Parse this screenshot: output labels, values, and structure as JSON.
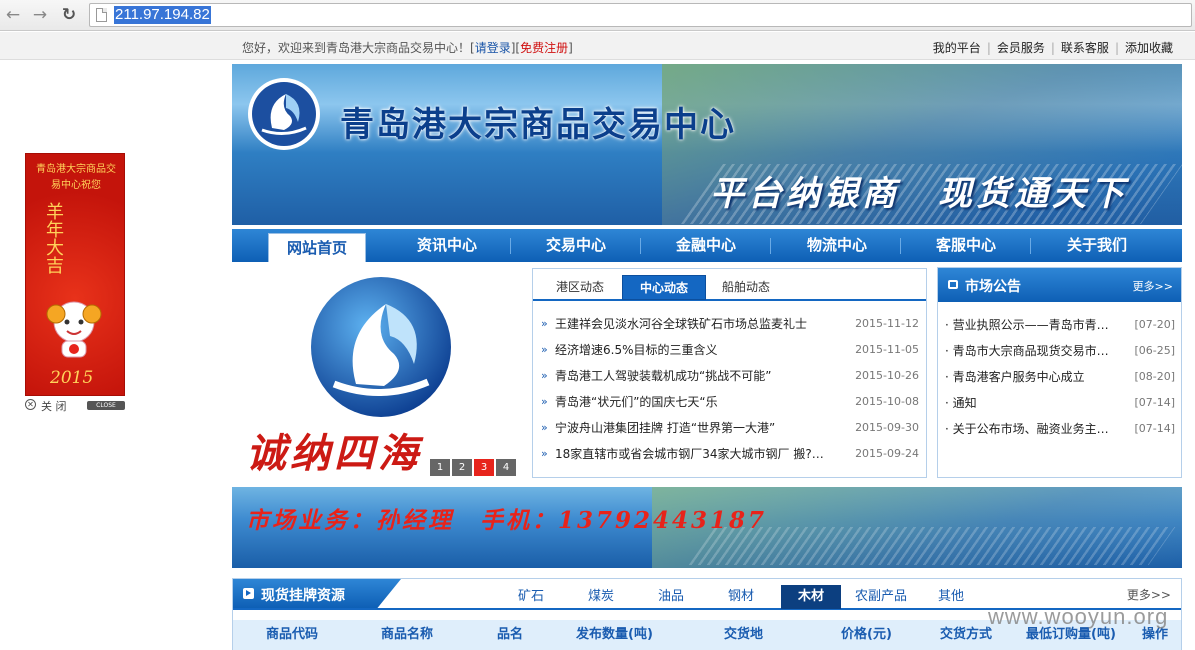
{
  "browser": {
    "url": "211.97.194.82"
  },
  "topbar": {
    "welcome": "您好，欢迎来到青岛港大宗商品交易中心！",
    "login_open": "[",
    "login": "请登录",
    "login_close": "]",
    "register_open": "[",
    "register": "免费注册",
    "register_close": "]",
    "links": [
      "我的平台",
      "会员服务",
      "联系客服",
      "添加收藏"
    ],
    "sep": "|"
  },
  "ad": {
    "top_text": "青岛港大宗商品交易中心祝您",
    "blessing": "羊年大吉",
    "year": "2015",
    "close_label": "关 闭",
    "close_button": "CLOSE"
  },
  "banner": {
    "title": "青岛港大宗商品交易中心",
    "slogan": "平台纳银商　现货通天下"
  },
  "nav": {
    "items": [
      "网站首页",
      "资讯中心",
      "交易中心",
      "金融中心",
      "物流中心",
      "客服中心",
      "关于我们"
    ],
    "active_index": 0
  },
  "slide": {
    "calligraphy": "诚纳四海",
    "dots": [
      "1",
      "2",
      "3",
      "4"
    ],
    "active": 2
  },
  "news": {
    "tabs": [
      "港区动态",
      "中心动态",
      "船舶动态"
    ],
    "active_tab": 1,
    "bullet": "»",
    "items": [
      {
        "title": "王建祥会见淡水河谷全球铁矿石市场总监麦礼士",
        "date": "2015-11-12"
      },
      {
        "title": "经济增速6.5%目标的三重含义",
        "date": "2015-11-05"
      },
      {
        "title": "青岛港工人驾驶装载机成功“挑战不可能”",
        "date": "2015-10-26"
      },
      {
        "title": "青岛港“状元们”的国庆七天“乐",
        "date": "2015-10-08"
      },
      {
        "title": "宁波舟山港集团挂牌 打造“世界第一大港”",
        "date": "2015-09-30"
      },
      {
        "title": "18家直辖市或省会城市钢厂34家大城市钢厂 搬?…",
        "date": "2015-09-24"
      }
    ]
  },
  "notice": {
    "title": "市场公告",
    "more": "更多>>",
    "items": [
      {
        "title": "· 营业执照公示——青岛市青…",
        "date": "[07-20]"
      },
      {
        "title": "· 青岛市大宗商品现货交易市…",
        "date": "[06-25]"
      },
      {
        "title": "· 青岛港客户服务中心成立",
        "date": "[08-20]"
      },
      {
        "title": "· 通知",
        "date": "[07-14]"
      },
      {
        "title": "· 关于公布市场、融资业务主…",
        "date": "[07-14]"
      }
    ]
  },
  "banner2": {
    "text": "市场业务：孙经理　手机：13792443187"
  },
  "resources": {
    "title": "现货挂牌资源",
    "tabs": [
      "矿石",
      "煤炭",
      "油品",
      "钢材",
      "木材",
      "农副产品",
      "其他"
    ],
    "active_tab": 4,
    "more": "更多>>",
    "columns": [
      "商品代码",
      "商品名称",
      "品名",
      "发布数量(吨)",
      "交货地",
      "价格(元)",
      "交货方式",
      "最低订购量(吨)",
      "操作"
    ]
  },
  "watermark": "www.wooyun.org",
  "colors": {
    "nav_blue": "#0e5fb5",
    "link_red": "#d01010",
    "accent_red": "#e7241c"
  }
}
